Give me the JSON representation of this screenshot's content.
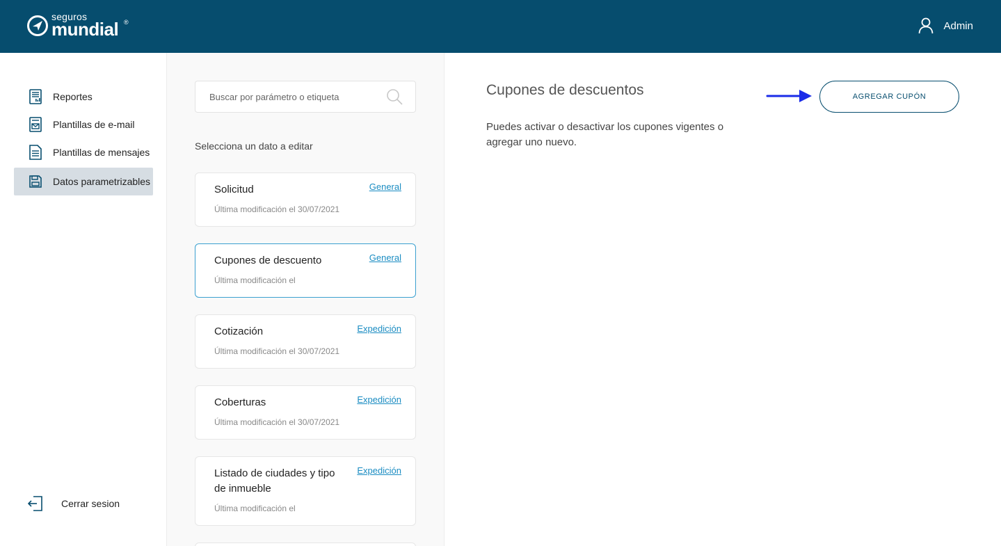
{
  "header": {
    "logo_small": "seguros",
    "logo_big": "mundial",
    "logo_reg": "®",
    "user_name": "Admin",
    "brand_color": "#064d6e"
  },
  "sidebar": {
    "items": [
      {
        "label": "Reportes",
        "icon": "report-icon",
        "active": false
      },
      {
        "label": "Plantillas de e-mail",
        "icon": "email-template-icon",
        "active": false
      },
      {
        "label": "Plantillas de mensajes",
        "icon": "message-template-icon",
        "active": false
      },
      {
        "label": "Datos parametrizables",
        "icon": "database-icon",
        "active": true
      }
    ],
    "logout_label": "Cerrar sesion"
  },
  "middle": {
    "search_placeholder": "Buscar por parámetro o etiqueta",
    "select_label": "Selecciona un dato a editar",
    "cards": [
      {
        "title": "Solicitud",
        "tag": "General",
        "date": "Última modificación el 30/07/2021",
        "active": false
      },
      {
        "title": "Cupones de descuento",
        "tag": "General",
        "date": "Última modificación el",
        "active": true
      },
      {
        "title": "Cotización",
        "tag": "Expedición",
        "date": "Última modificación el 30/07/2021",
        "active": false
      },
      {
        "title": "Coberturas",
        "tag": "Expedición",
        "date": "Última modificación el 30/07/2021",
        "active": false
      },
      {
        "title": "Listado de ciudades y tipo de inmueble",
        "tag": "Expedición",
        "date": "Última modificación el",
        "active": false
      }
    ]
  },
  "content": {
    "title": "Cupones de descuentos",
    "description": "Puedes activar o desactivar los cupones vigentes o agregar uno nuevo.",
    "add_button": "AGREGAR CUPÓN",
    "arrow_color": "#1a2be8"
  }
}
